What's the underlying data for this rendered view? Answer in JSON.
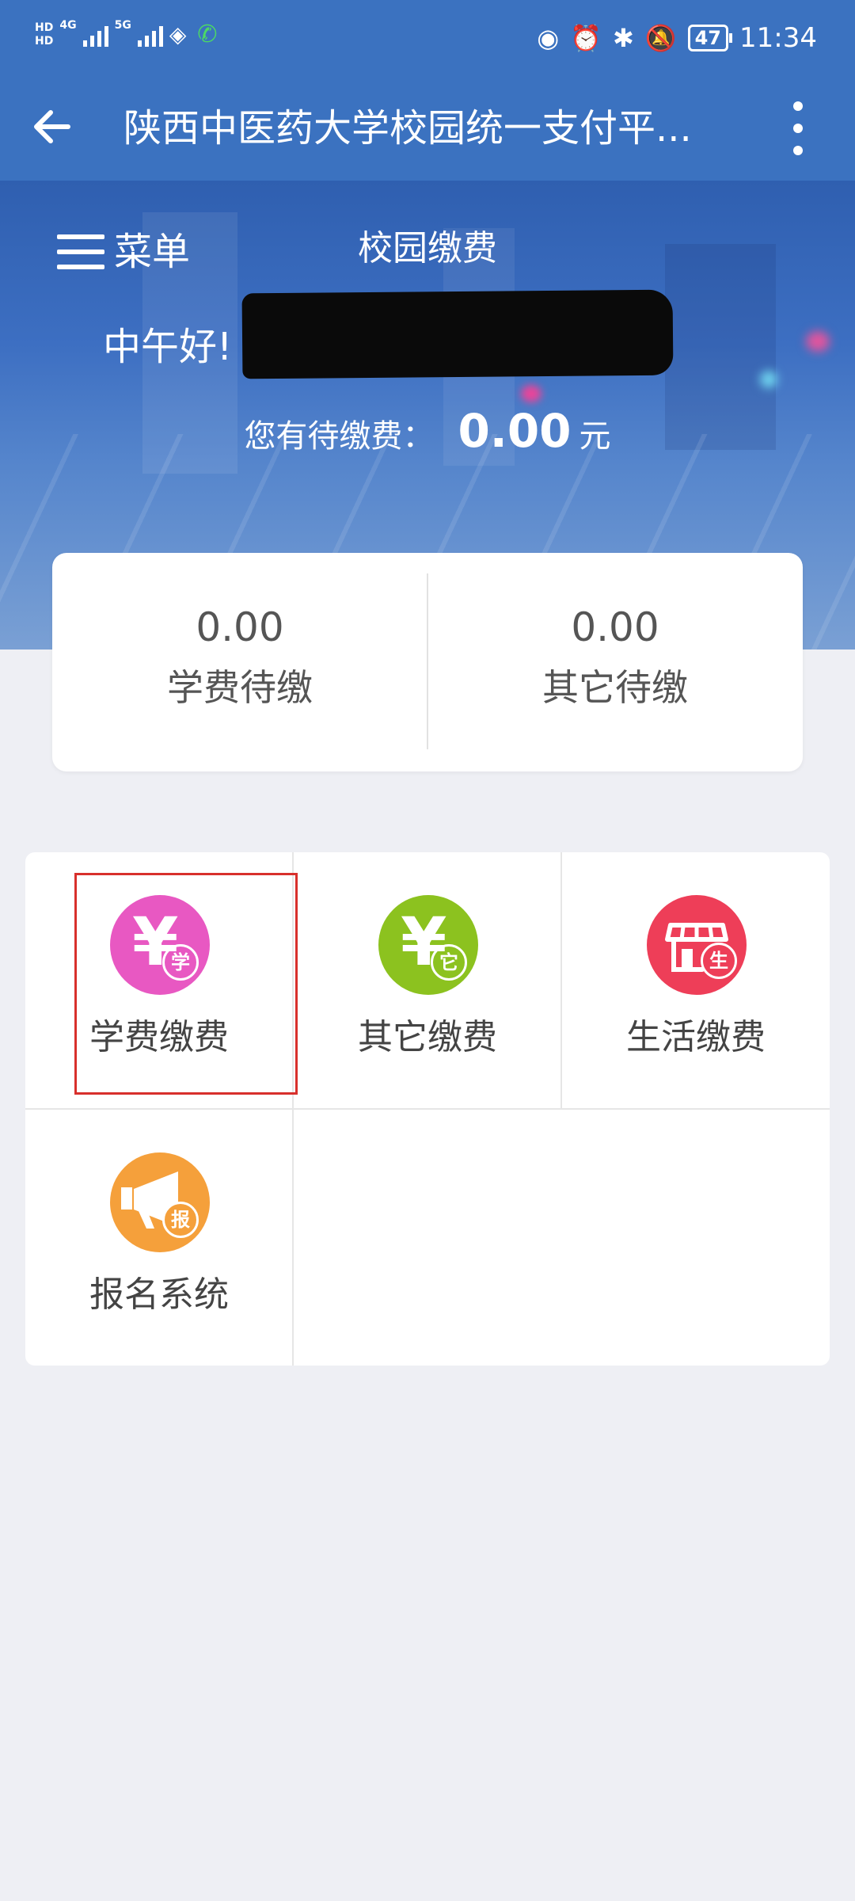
{
  "status_bar": {
    "hd1": "HD",
    "hd2": "HD",
    "net1": "4G",
    "net2": "5G",
    "battery": "47",
    "time": "11:34"
  },
  "app_bar": {
    "title": "陕西中医药大学校园统一支付平..."
  },
  "header": {
    "menu_label": "菜单",
    "section_title": "校园缴费",
    "greeting": "中午好!",
    "pending_label": "您有待缴费：",
    "pending_amount": "0.00",
    "pending_unit": "元"
  },
  "summary": [
    {
      "value": "0.00",
      "label": "学费待缴"
    },
    {
      "value": "0.00",
      "label": "其它待缴"
    }
  ],
  "services": [
    {
      "label": "学费缴费",
      "icon": "tuition-fee-icon",
      "badge": "学",
      "color": "#e858c2"
    },
    {
      "label": "其它缴费",
      "icon": "other-fee-icon",
      "badge": "它",
      "color": "#8cc21f"
    },
    {
      "label": "生活缴费",
      "icon": "living-fee-icon",
      "badge": "生",
      "color": "#ee3e58"
    },
    {
      "label": "报名系统",
      "icon": "registration-icon",
      "badge": "报",
      "color": "#f5a03b"
    }
  ],
  "colors": {
    "primary": "#3b72c0",
    "highlight": "#d8302c"
  }
}
